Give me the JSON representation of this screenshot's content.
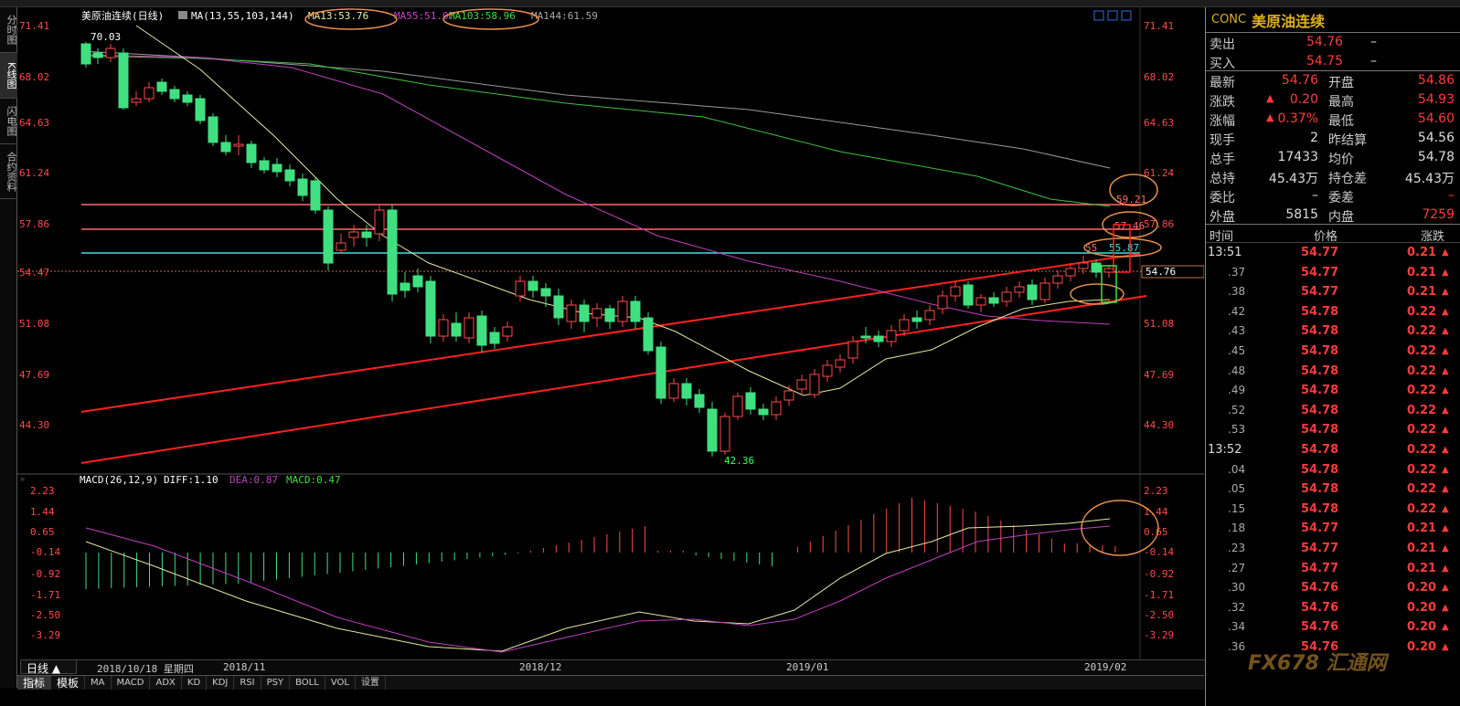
{
  "left_tabs": [
    {
      "label": "分时图"
    },
    {
      "label": "K线图"
    },
    {
      "label": "闪电图"
    },
    {
      "label": "合约资料"
    }
  ],
  "chart": {
    "header_name": "美原油连续(日线)",
    "ma_label": "MA(13,55,103,144)",
    "ma13": "MA13:53.76",
    "ma55": "MA55:51.07",
    "ma103": "MA103:58.96",
    "ma144": "MA144:61.59",
    "price_ticks": [
      "71.41",
      "68.02",
      "64.63",
      "61.24",
      "57.86",
      "54.47",
      "51.08",
      "47.69",
      "44.30"
    ],
    "high_label": "70.03",
    "low_label": "42.36",
    "current_price_tag": "54.76",
    "level_labels": [
      "59.21",
      "57.46",
      "55.87"
    ],
    "level_partial": "55",
    "macd_label": "MACD(26,12,9)",
    "diff": "DIFF:1.10",
    "dea": "DEA:0.87",
    "macd": "MACD:0.47",
    "macd_ticks": [
      "2.23",
      "1.44",
      "0.65",
      "-0.14",
      "-0.92",
      "-1.71",
      "-2.50",
      "-3.29"
    ]
  },
  "period_label": "日线 ▲",
  "date_axis": {
    "cursor": "2018/10/18 星期四",
    "labels": [
      "2018/11",
      "2018/12",
      "2019/01",
      "2019/02"
    ]
  },
  "bottom_tabs": [
    "指标",
    "模板",
    "MA",
    "MACD",
    "ADX",
    "KD",
    "KDJ",
    "RSI",
    "PSY",
    "BOLL",
    "VOL",
    "设置"
  ],
  "panel": {
    "code": "CONC",
    "name": "美原油连续",
    "sell": {
      "label": "卖出",
      "price": "54.76",
      "vol": "–"
    },
    "buy": {
      "label": "买入",
      "price": "54.75",
      "vol": "–"
    },
    "quote_rows": [
      {
        "l1": "最新",
        "v1": "54.76",
        "l2": "开盘",
        "v2": "54.86"
      },
      {
        "l1": "涨跌",
        "v1": "0.20",
        "l2": "最高",
        "v2": "54.93"
      },
      {
        "l1": "涨幅",
        "v1": "0.37%",
        "l2": "最低",
        "v2": "54.60"
      },
      {
        "l1": "现手",
        "v1": "2",
        "l2": "昨结算",
        "v2": "54.56"
      },
      {
        "l1": "总手",
        "v1": "17433",
        "l2": "均价",
        "v2": "54.78"
      },
      {
        "l1": "总持",
        "v1": "45.43万",
        "l2": "持仓差",
        "v2": "45.43万"
      },
      {
        "l1": "委比",
        "v1": "–",
        "l2": "委差",
        "v2": "–"
      },
      {
        "l1": "外盘",
        "v1": "5815",
        "l2": "内盘",
        "v2": "7259"
      }
    ],
    "tick_header": {
      "time": "时间",
      "price": "价格",
      "change": "涨跌"
    },
    "ticks": [
      {
        "t": "13:51",
        "p": "54.77",
        "c": "0.21"
      },
      {
        "t": ".37",
        "p": "54.77",
        "c": "0.21"
      },
      {
        "t": ".38",
        "p": "54.77",
        "c": "0.21"
      },
      {
        "t": ".42",
        "p": "54.78",
        "c": "0.22"
      },
      {
        "t": ".43",
        "p": "54.78",
        "c": "0.22"
      },
      {
        "t": ".45",
        "p": "54.78",
        "c": "0.22"
      },
      {
        "t": ".48",
        "p": "54.78",
        "c": "0.22"
      },
      {
        "t": ".49",
        "p": "54.78",
        "c": "0.22"
      },
      {
        "t": ".52",
        "p": "54.78",
        "c": "0.22"
      },
      {
        "t": ".53",
        "p": "54.78",
        "c": "0.22"
      },
      {
        "t": "13:52",
        "p": "54.78",
        "c": "0.22"
      },
      {
        "t": ".04",
        "p": "54.78",
        "c": "0.22"
      },
      {
        "t": ".05",
        "p": "54.78",
        "c": "0.22"
      },
      {
        "t": ".15",
        "p": "54.78",
        "c": "0.22"
      },
      {
        "t": ".18",
        "p": "54.77",
        "c": "0.21"
      },
      {
        "t": ".23",
        "p": "54.77",
        "c": "0.21"
      },
      {
        "t": ".27",
        "p": "54.77",
        "c": "0.21"
      },
      {
        "t": ".30",
        "p": "54.76",
        "c": "0.20"
      },
      {
        "t": ".32",
        "p": "54.76",
        "c": "0.20"
      },
      {
        "t": ".34",
        "p": "54.76",
        "c": "0.20"
      },
      {
        "t": ".36",
        "p": "54.76",
        "c": "0.20"
      }
    ],
    "watermark": "FX678 汇通网"
  }
}
